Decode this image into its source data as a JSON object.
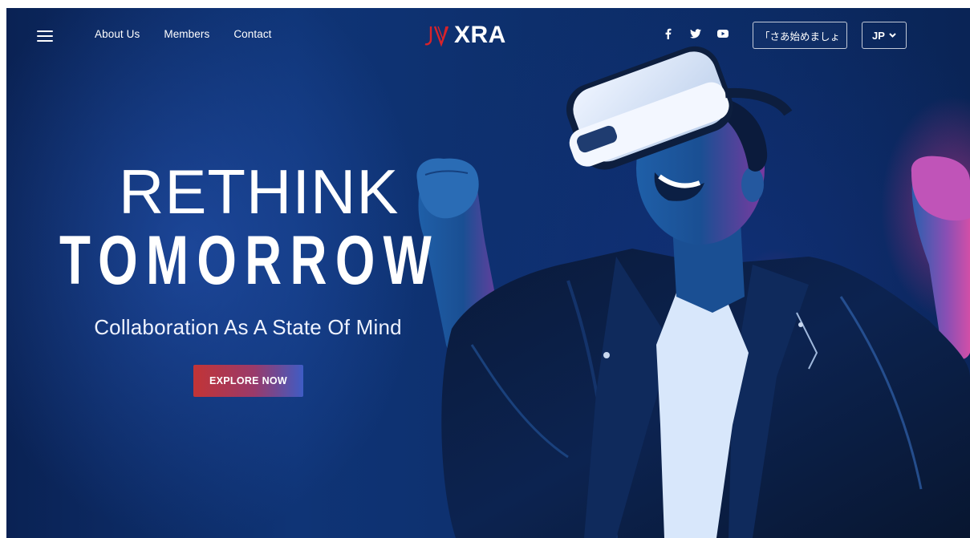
{
  "nav": {
    "links": [
      "About Us",
      "Members",
      "Contact"
    ],
    "logo_text": "XRA",
    "social_icons": [
      "facebook-icon",
      "twitter-icon",
      "youtube-icon"
    ],
    "start_button": "「さあ始めましょ",
    "language": "JP"
  },
  "hero": {
    "title_line1": "RETHINK",
    "title_line2": "TOMORROW",
    "subtitle": "Collaboration As A State Of Mind",
    "cta": "EXPLORE NOW"
  },
  "colors": {
    "background": "#0f3476",
    "logo_accent": "#d8232a",
    "cta_start": "#c23436",
    "cta_end": "#3f5cc4"
  }
}
